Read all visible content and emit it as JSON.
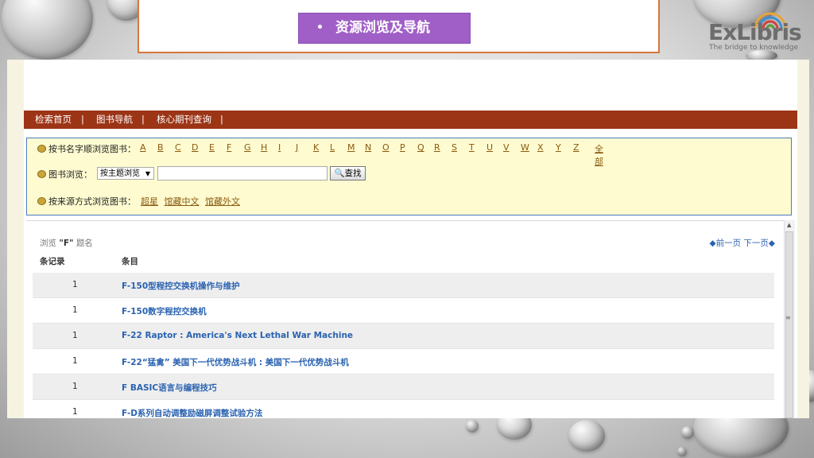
{
  "slide": {
    "title": "资源浏览及导航",
    "title_bullet": "•"
  },
  "logo": {
    "brand": "ExLibris",
    "tagline": "The bridge to knowledge",
    "colors": [
      "#e8a33a",
      "#3f8fcf",
      "#d1413a",
      "#5a9a3a"
    ]
  },
  "navbar": {
    "items": [
      "检索首页",
      "图书导航",
      "核心期刊查询"
    ],
    "separator": "|"
  },
  "search": {
    "by_title_label": "按书名字顺浏览图书：",
    "letters": [
      "A",
      "B",
      "C",
      "D",
      "E",
      "F",
      "G",
      "H",
      "I",
      "J",
      "K",
      "L",
      "M",
      "N",
      "O",
      "P",
      "Q",
      "R",
      "S",
      "T",
      "U",
      "V",
      "W",
      "X",
      "Y",
      "Z"
    ],
    "all_label": "全部",
    "browse_label": "图书浏览：",
    "browse_select_value": "按主题浏览",
    "browse_input_value": "",
    "find_button": "查找",
    "by_source_label": "按来源方式浏览图书：",
    "sources": [
      "超星",
      "馆藏中文",
      "馆藏外文"
    ]
  },
  "results": {
    "browse_prefix": "浏览",
    "browse_term": "\"F\"",
    "browse_suffix": "题名",
    "prev_page": "前一页",
    "next_page": "下一页",
    "col_count": "条记录",
    "col_entry": "条目",
    "rows": [
      {
        "count": "1",
        "title": "F-150型程控交换机操作与维护"
      },
      {
        "count": "1",
        "title": "F-150数字程控交换机"
      },
      {
        "count": "1",
        "title": "F-22 Raptor : America's Next Lethal War Machine"
      },
      {
        "count": "1",
        "title": "F-22“猛禽” 美国下一代优势战斗机 : 美国下一代优势战斗机"
      },
      {
        "count": "1",
        "title": "F BASIC语言与编程技巧"
      },
      {
        "count": "1",
        "title": "F-D系列自动调整励磁屏调整试验方法"
      }
    ]
  }
}
